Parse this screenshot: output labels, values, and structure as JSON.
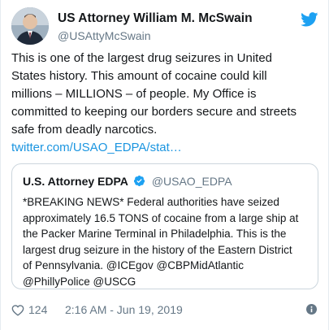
{
  "author": {
    "name": "US Attorney William M. McSwain",
    "handle": "@USAttyMcSwain"
  },
  "tweet": {
    "lines": [
      "This is one of the largest drug seizures in United",
      "States history. This amount of cocaine could kill",
      "millions – MILLIONS – of people. My Office is",
      "committed to keeping our borders secure and streets",
      "safe from deadly narcotics."
    ],
    "link": "twitter.com/USAO_EDPA/stat…"
  },
  "quoted_tweet": {
    "name": "U.S. Attorney EDPA",
    "handle": "@USAO_EDPA",
    "lines": [
      "*BREAKING NEWS* Federal authorities have seized",
      "approximately 16.5 TONS of cocaine from a large ship at",
      "the Packer Marine Terminal in Philadelphia. This is the",
      "largest drug seizure in the history of the Eastern District",
      "of Pennsylvania. @ICEgov @CBPMidAtlantic",
      "@PhillyPolice @USCG"
    ]
  },
  "footer": {
    "like_count": "124",
    "timestamp": "2:16 AM - Jun 19, 2019"
  },
  "icons": {
    "twitter_logo": "twitter-bird-icon",
    "verified": "verified-badge-icon",
    "like": "heart-icon",
    "info": "info-icon"
  },
  "colors": {
    "brand_blue": "#1da1f2",
    "link": "#1b95e0",
    "text": "#14171a",
    "muted": "#657786",
    "border": "#ccd6dd"
  }
}
